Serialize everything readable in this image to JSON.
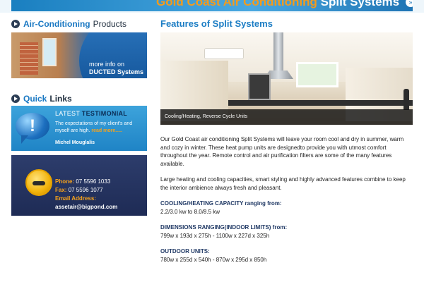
{
  "banner": {
    "title_highlight": "Gold Coast Air Conditioning",
    "title_rest": " Split Systems",
    "circle_glyph": "»"
  },
  "sidebar": {
    "products_heading_accent": "Air-Conditioning",
    "products_heading_rest": "Products",
    "ducted": {
      "line1": "more info on",
      "line2": "DUCTED Systems"
    },
    "quick_heading_accent": "Quick",
    "quick_heading_rest": "Links",
    "testimonial": {
      "title_light": "LATEST",
      "title_bold": "TESTIMONIAL",
      "body": "The expectations of my client's and myself are high.",
      "read_more": "read more.....",
      "author": "Michel Mouglalis"
    },
    "contact": {
      "phone_label": "Phone:",
      "phone_value": "07 5596 1033",
      "fax_label": "Fax:",
      "fax_value": "07 5596 1077",
      "email_label": "Email Address:",
      "email_value": "assetair@bigpond.com"
    }
  },
  "main": {
    "title": "Features of Split Systems",
    "hero_caption": "Cooling/Heating, Reverse Cycle Units",
    "paragraph1": "Our Gold Coast air conditioning Split Systems will leave your room cool and dry in summer, warm and cozy in winter. These heat pump units are designedto provide you with utmost comfort throughout the year. Remote control and air purification filters are some of the many features available.",
    "paragraph2": "Large heating and cooling capacities, smart styling and highly advanced features combine to keep the interior ambience always fresh and pleasant.",
    "specs": [
      {
        "label": "COOLING/HEATING CAPACITY ranging from:",
        "value": "2.2/3.0 kw to 8.0/8.5 kw"
      },
      {
        "label": "DIMENSIONS RANGING(INDOOR LIMITS) from:",
        "value": "799w x 193d x 275h - 1100w x 227d x 325h"
      },
      {
        "label": "OUTDOOR UNITS:",
        "value": "780w x 255d x 540h - 870w x 295d x 850h"
      }
    ]
  },
  "colors": {
    "accent_blue": "#1c7dc4",
    "accent_orange": "#f6a21c",
    "navy": "#1f3864"
  }
}
